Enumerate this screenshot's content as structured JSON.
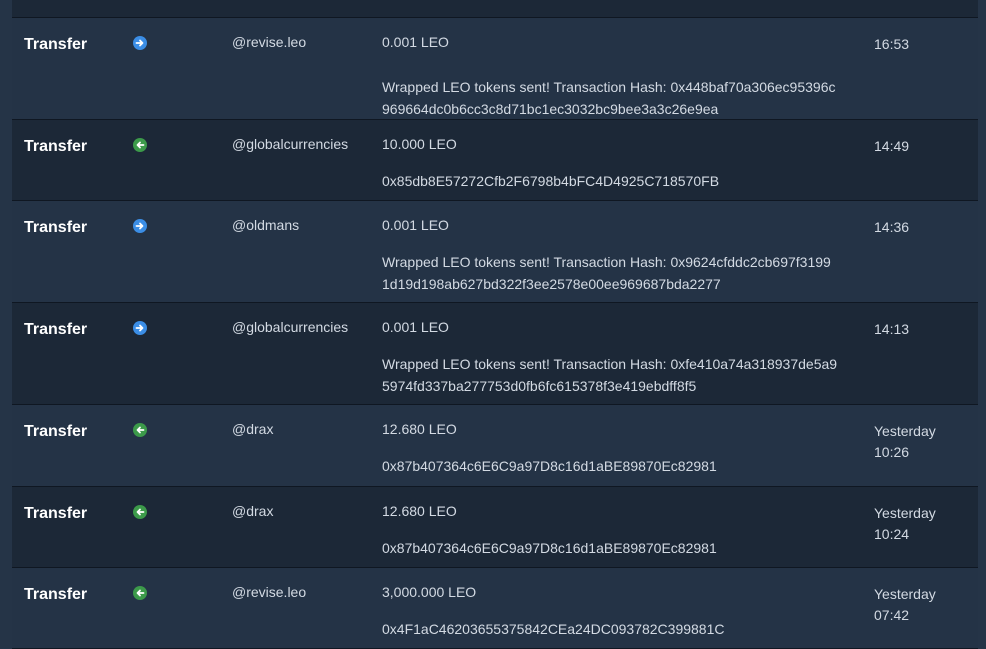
{
  "transactions": [
    {
      "type": "Transfer",
      "direction": "out",
      "user": "@revise.leo",
      "amount": "0.001 LEO",
      "memo_line1": "Wrapped LEO tokens sent! Transaction Hash: 0x448baf70a306ec95396c",
      "memo_line2": "969664dc0b6cc3c8d71bc1ec3032bc9bee3a3c26e9ea",
      "time_line1": "16:53",
      "time_line2": ""
    },
    {
      "type": "Transfer",
      "direction": "in",
      "user": "@globalcurrencies",
      "amount": "10.000 LEO",
      "memo_line1": "0x85db8E57272Cfb2F6798b4bFC4D4925C718570FB",
      "memo_line2": "",
      "time_line1": "14:49",
      "time_line2": ""
    },
    {
      "type": "Transfer",
      "direction": "out",
      "user": "@oldmans",
      "amount": "0.001 LEO",
      "memo_line1": "Wrapped LEO tokens sent! Transaction Hash: 0x9624cfddc2cb697f3199",
      "memo_line2": "1d19d198ab627bd322f3ee2578e00ee969687bda2277",
      "time_line1": "14:36",
      "time_line2": ""
    },
    {
      "type": "Transfer",
      "direction": "out",
      "user": "@globalcurrencies",
      "amount": "0.001 LEO",
      "memo_line1": "Wrapped LEO tokens sent! Transaction Hash: 0xfe410a74a318937de5a9",
      "memo_line2": "5974fd337ba277753d0fb6fc615378f3e419ebdff8f5",
      "time_line1": "14:13",
      "time_line2": ""
    },
    {
      "type": "Transfer",
      "direction": "in",
      "user": "@drax",
      "amount": "12.680 LEO",
      "memo_line1": "0x87b407364c6E6C9a97D8c16d1aBE89870Ec82981",
      "memo_line2": "",
      "time_line1": "Yesterday",
      "time_line2": "10:26"
    },
    {
      "type": "Transfer",
      "direction": "in",
      "user": "@drax",
      "amount": "12.680 LEO",
      "memo_line1": "0x87b407364c6E6C9a97D8c16d1aBE89870Ec82981",
      "memo_line2": "",
      "time_line1": "Yesterday",
      "time_line2": "10:24"
    },
    {
      "type": "Transfer",
      "direction": "in",
      "user": "@revise.leo",
      "amount": "3,000.000 LEO",
      "memo_line1": "0x4F1aC46203655375842CEa24DC093782C399881C",
      "memo_line2": "",
      "time_line1": "Yesterday",
      "time_line2": "07:42"
    }
  ],
  "colors": {
    "out_icon": "#3b8ee6",
    "in_icon": "#3c9a4a",
    "row_dark": "#1c2837",
    "row_light": "#243346"
  },
  "icons": {
    "out": "arrow-right-circle-icon",
    "in": "arrow-left-circle-icon"
  }
}
